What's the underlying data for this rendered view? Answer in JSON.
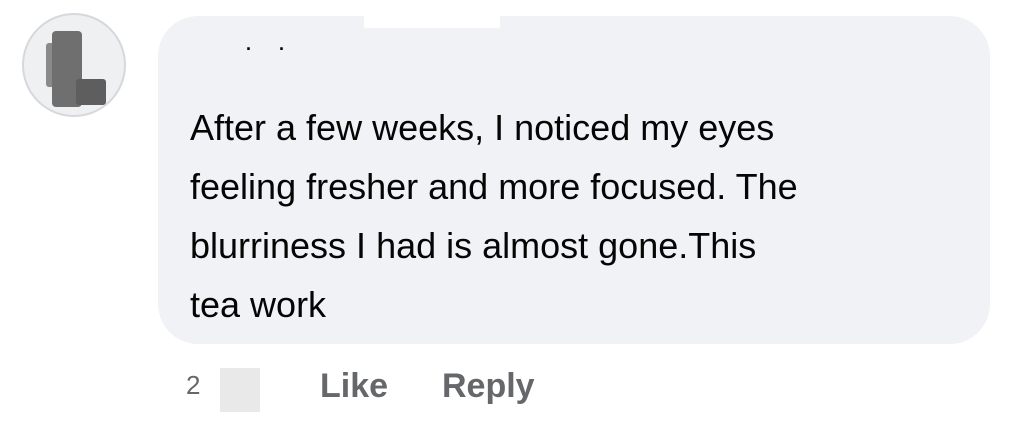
{
  "comment": {
    "author": "..",
    "text": "After a few weeks, I noticed my eyes\nfeeling fresher and more focused. The\nblurriness I had is almost gone.This\ntea work",
    "timestamp": "2"
  },
  "actions": {
    "like_label": "Like",
    "reply_label": "Reply"
  },
  "colors": {
    "bubble": "#f0f2f5",
    "text": "#050505",
    "secondary": "#65676b"
  }
}
